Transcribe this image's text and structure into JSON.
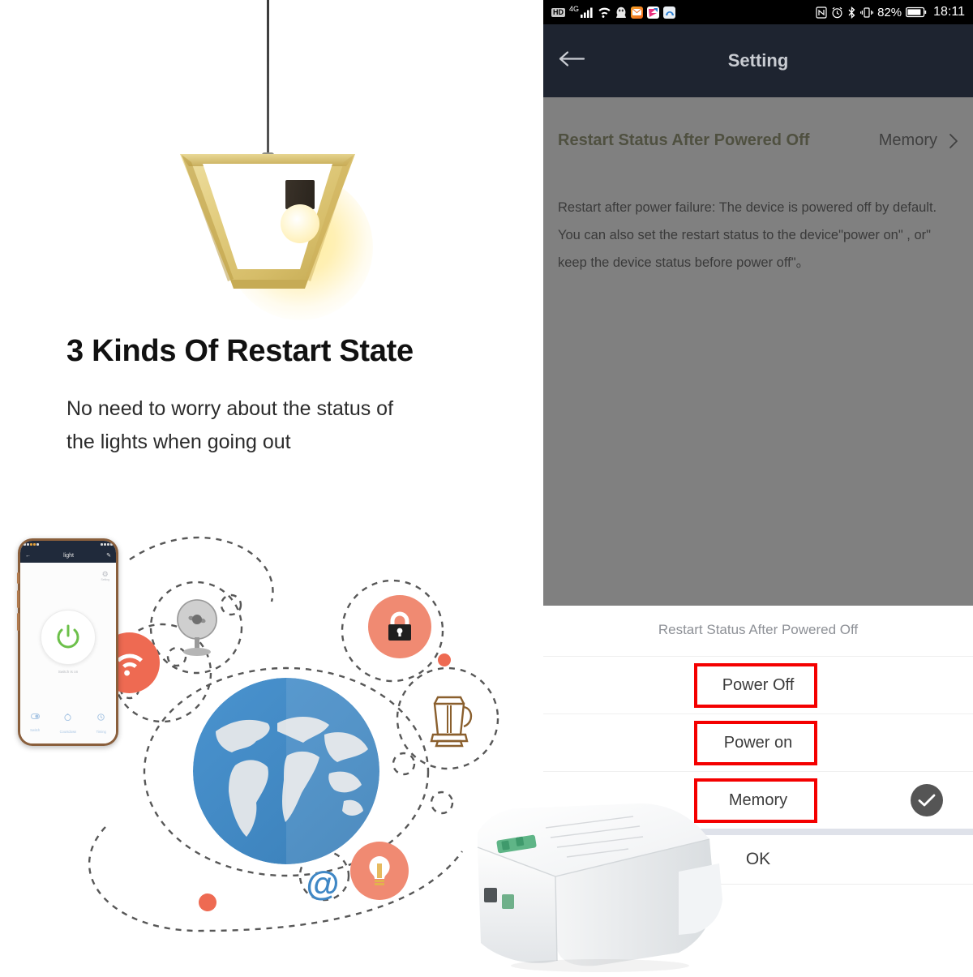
{
  "marketing": {
    "headline": "3 Kinds Of Restart State",
    "sub_line_1": "No need to worry about the status of",
    "sub_line_2": "the lights when going out",
    "lamp_icon": "pendant-lamp",
    "globe_icon": "globe-icon",
    "iot_icons": [
      "fan-icon",
      "wifi-icon",
      "lock-icon",
      "kettle-icon",
      "bulb-icon",
      "email-icon"
    ],
    "device_icon": "smart-switch-device"
  },
  "mini_phone": {
    "back_icon": "back-arrow-icon",
    "title": "light",
    "edit_icon": "edit-pencil-icon",
    "gear_icon": "gear-icon",
    "gear_label": "Setting",
    "power_icon": "power-icon",
    "status_text": "Switch is on",
    "tabs": [
      {
        "label": "Switch",
        "icon": "toggle-icon"
      },
      {
        "label": "Countdown",
        "icon": "timer-icon"
      },
      {
        "label": "Timing",
        "icon": "clock-icon"
      }
    ]
  },
  "phone": {
    "status_bar": {
      "hd_badge": "HD",
      "network": "4G",
      "signal_icon": "signal-bars-icon",
      "wifi_icon": "wifi-icon",
      "qq_icon": "qq-penguin-icon",
      "mail_icon": "mail-app-icon",
      "app3_icon": "app-icon-pink",
      "app4_icon": "app-icon-blue",
      "nfc_icon": "nfc-icon",
      "alarm_icon": "alarm-icon",
      "bluetooth_icon": "bluetooth-icon",
      "vibrate_icon": "vibrate-icon",
      "battery_percent": "82%",
      "battery_icon": "battery-icon",
      "time": "18:11"
    },
    "nav": {
      "back_icon": "back-arrow-icon",
      "title": "Setting"
    },
    "settings": {
      "row_label": "Restart Status After Powered Off",
      "row_value": "Memory",
      "chevron_icon": "chevron-right-icon",
      "description": "Restart after power failure: The device is powered off by default. You can also set the restart status to the device\"power on\" , or\" keep the device status before power off\"。"
    },
    "dialog": {
      "title": "Restart Status After Powered Off",
      "options": [
        {
          "label": "Power Off",
          "selected": false,
          "highlighted": true
        },
        {
          "label": "Power on",
          "selected": false,
          "highlighted": true
        },
        {
          "label": "Memory",
          "selected": true,
          "highlighted": true
        }
      ],
      "check_icon": "check-circle-icon",
      "confirm_label": "OK"
    }
  },
  "colors": {
    "highlight_red": "#f40000",
    "nav_dark": "#1e2430",
    "dim_overlay": "#808080",
    "accent_green": "#6cc04a",
    "globe_blue": "#3f87c5",
    "bubble_red": "#ee6a52"
  }
}
